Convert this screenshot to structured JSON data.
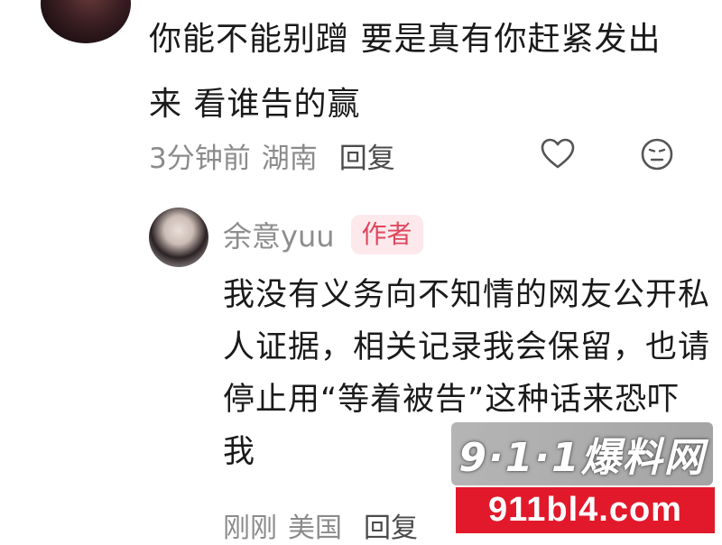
{
  "comment": {
    "text": "你能不能别蹭 要是真有你赶紧发出来 看谁告的赢",
    "time": "3分钟前",
    "location": "湖南",
    "reply_label": "回复",
    "like_icon": "heart-icon",
    "emoji_icon": "emoji-icon"
  },
  "reply": {
    "name": "余意yuu",
    "badge": "作者",
    "text": "我没有义务向不知情的网友公开私人证据，相关记录我会保留，也请停止用“等着被告”这种话来恐吓我",
    "time": "刚刚",
    "location": "美国",
    "reply_label": "回复"
  },
  "watermark": {
    "brand": "9·1·1爆料网",
    "url": "911bl4.com",
    "color": "#e2192b"
  }
}
